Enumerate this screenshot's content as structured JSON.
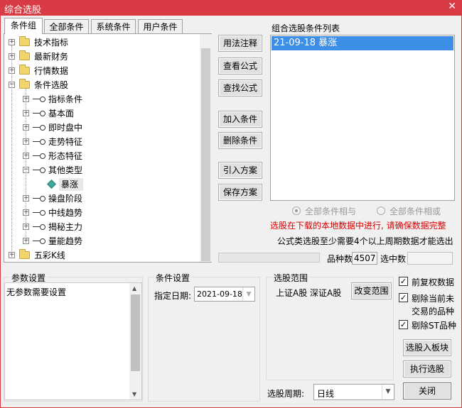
{
  "window": {
    "title": "综合选股",
    "close_label": "✕"
  },
  "tabs": [
    "条件组",
    "全部条件",
    "系统条件",
    "用户条件"
  ],
  "tree": [
    {
      "label": "技术指标",
      "type": "folder",
      "expander": "+"
    },
    {
      "label": "最新财务",
      "type": "folder",
      "expander": "+"
    },
    {
      "label": "行情数据",
      "type": "folder",
      "expander": "+"
    },
    {
      "label": "条件选股",
      "type": "folder",
      "expander": "−"
    },
    {
      "label": "指标条件",
      "type": "key",
      "expander": "+"
    },
    {
      "label": "基本面",
      "type": "key",
      "expander": "+"
    },
    {
      "label": "即时盘中",
      "type": "key",
      "expander": "+"
    },
    {
      "label": "走势特征",
      "type": "key",
      "expander": "+"
    },
    {
      "label": "形态特征",
      "type": "key",
      "expander": "+"
    },
    {
      "label": "其他类型",
      "type": "key",
      "expander": "−"
    },
    {
      "label": "暴涨",
      "type": "leaf",
      "expander": ""
    },
    {
      "label": "操盘阶段",
      "type": "key",
      "expander": "+"
    },
    {
      "label": "中线趋势",
      "type": "key",
      "expander": "+"
    },
    {
      "label": "揭秘主力",
      "type": "key",
      "expander": "+"
    },
    {
      "label": "量能趋势",
      "type": "key",
      "expander": "+"
    },
    {
      "label": "五彩K线",
      "type": "folder",
      "expander": "+"
    }
  ],
  "middle_buttons": {
    "usage": "用法注释",
    "view_formula": "查看公式",
    "find_formula": "查找公式",
    "add_condition": "加入条件",
    "delete_condition": "删除条件",
    "import_plan": "引入方案",
    "save_plan": "保存方案"
  },
  "condition_list": {
    "title": "组合选股条件列表",
    "items": [
      "21-09-18 暴涨"
    ]
  },
  "logic": {
    "and_label": "全部条件相与",
    "or_label": "全部条件相或"
  },
  "notice_red": "选股在下载的本地数据中进行, 请确保数据完整",
  "notice": "公式类选股至少需要4个以上周期数据才能选出",
  "counts": {
    "total_label": "品种数",
    "total_value": "4507",
    "selected_label": "选中数",
    "selected_value": ""
  },
  "params": {
    "title": "参数设置",
    "text": "无参数需要设置"
  },
  "cond_settings": {
    "title": "条件设置",
    "date_label": "指定日期:",
    "date_value": "2021-09-18"
  },
  "range": {
    "title": "选股范围",
    "markets": "上证A股 深证A股",
    "change_button": "改变范围"
  },
  "options": {
    "restore_rights": "前复权数据",
    "exclude_untraded_1": "剔除当前未",
    "exclude_untraded_2": "交易的品种",
    "exclude_st": "剔除ST品种"
  },
  "period": {
    "label": "选股周期:",
    "value": "日线"
  },
  "bottom_buttons": {
    "to_block": "选股入板块",
    "execute": "执行选股",
    "close": "关闭"
  },
  "colors": {
    "accent": "#d93b45",
    "selection": "#3d8ee6",
    "notice_red": "#d80000"
  }
}
